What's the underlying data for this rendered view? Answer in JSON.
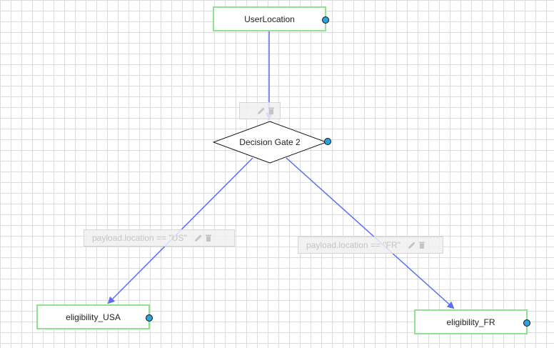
{
  "nodes": {
    "user_location": {
      "label": "UserLocation"
    },
    "decision_gate": {
      "label": "Decision Gate 2"
    },
    "eligibility_usa": {
      "label": "eligibility_USA"
    },
    "eligibility_fr": {
      "label": "eligibility_FR"
    }
  },
  "edges": [
    {
      "from": "UserLocation",
      "to": "Decision Gate 2",
      "condition": ""
    },
    {
      "from": "Decision Gate 2",
      "to": "eligibility_USA",
      "condition": "payload.location == \"US\""
    },
    {
      "from": "Decision Gate 2",
      "to": "eligibility_FR",
      "condition": "payload.location == \"FR\""
    }
  ],
  "icons": {
    "edit": "pencil-icon",
    "delete": "trash-icon",
    "port": "connector-port"
  },
  "colors": {
    "edge": "#5b6ef5",
    "node_border": "#8ee48e",
    "port": "#29a3e0",
    "grid": "#dcdcdc"
  }
}
